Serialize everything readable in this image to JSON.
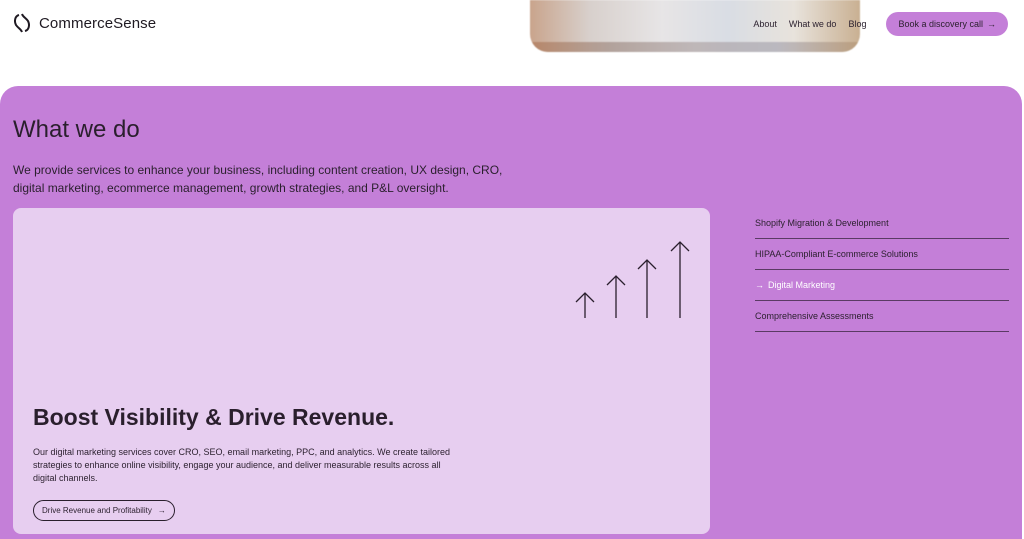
{
  "header": {
    "brand": "CommerceSense",
    "nav": [
      {
        "label": "About"
      },
      {
        "label": "What we do"
      },
      {
        "label": "Blog"
      }
    ],
    "cta_label": "Book a discovery call",
    "cta_icon": "arrow-right-icon"
  },
  "section": {
    "title": "What we do",
    "description": "We provide services to enhance your business, including content creation, UX design, CRO, digital marketing, ecommerce management, growth strategies, and P&L oversight."
  },
  "card": {
    "title": "Boost Visibility & Drive Revenue.",
    "text": "Our digital marketing services cover CRO, SEO, email marketing, PPC, and analytics. We create tailored strategies to enhance online visibility, engage your audience, and deliver measurable results across all digital channels.",
    "button_label": "Drive Revenue and Profitability",
    "illustration_icon": "rising-arrows-icon"
  },
  "services": [
    {
      "label": "Shopify Migration & Development",
      "active": false
    },
    {
      "label": "HIPAA-Compliant E-commerce Solutions",
      "active": false
    },
    {
      "label": "Digital Marketing",
      "active": true
    },
    {
      "label": "Comprehensive Assessments",
      "active": false
    }
  ],
  "colors": {
    "accent": "#c47fd8",
    "card": "#e7cef0",
    "text": "#2a1f2d"
  }
}
